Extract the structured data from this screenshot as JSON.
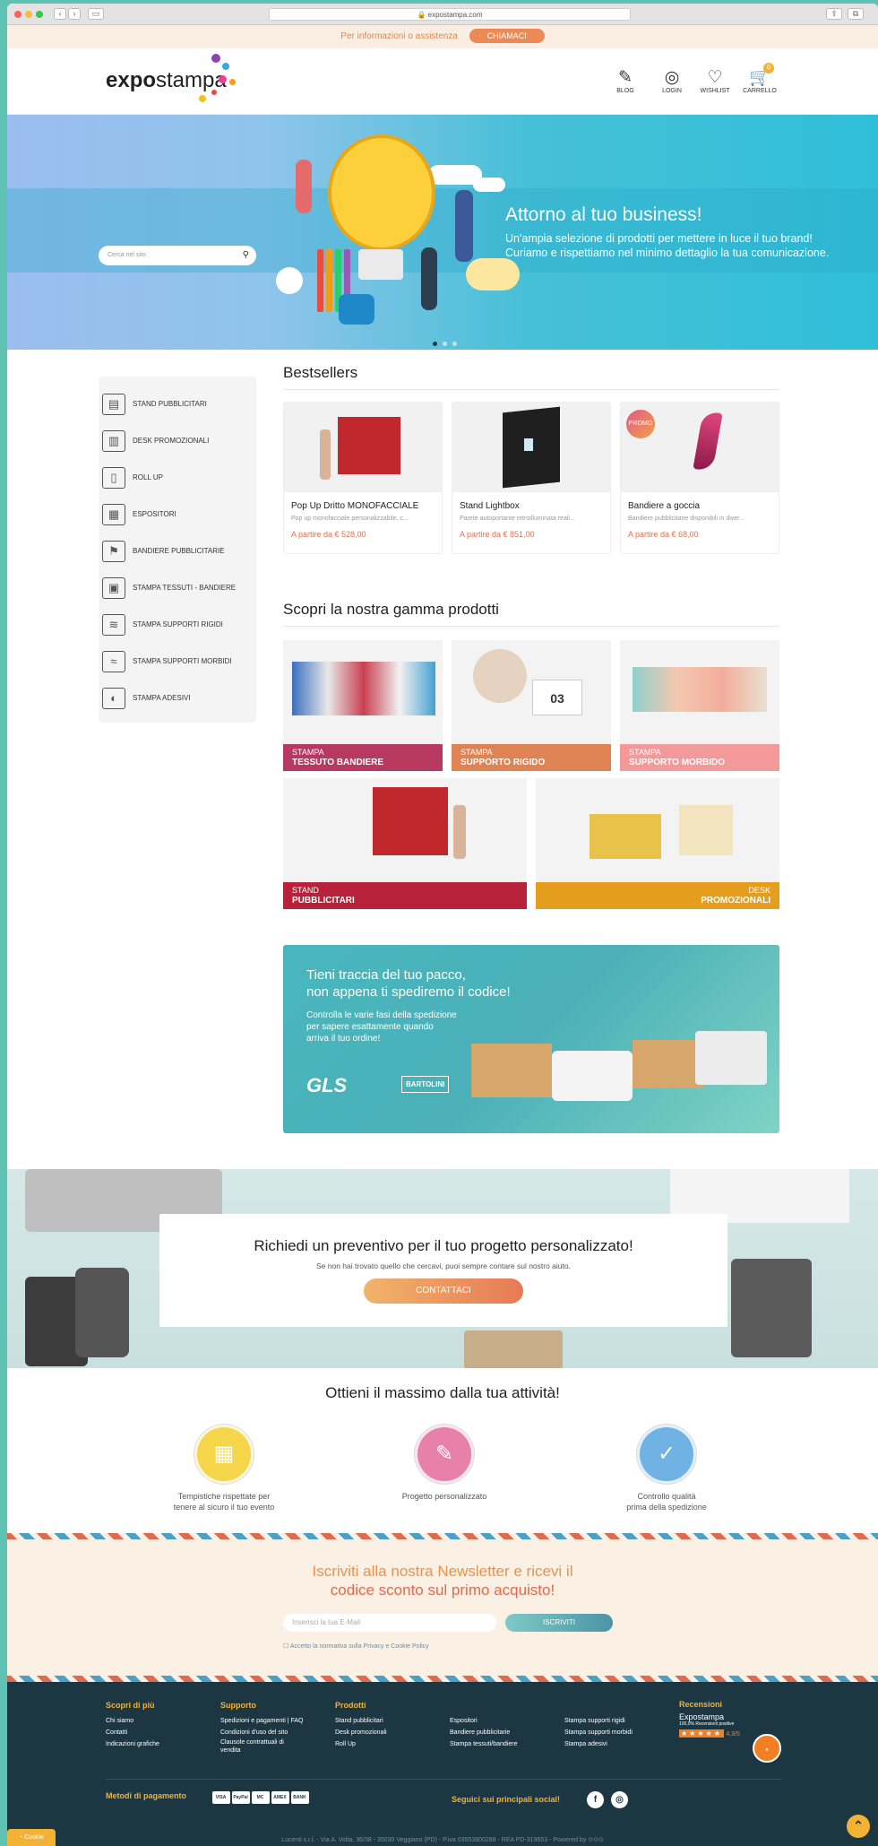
{
  "browser": {
    "url": "expostampa.com"
  },
  "topbar": {
    "text": "Per informazioni o assistenza",
    "button": "CHIAMACI"
  },
  "header": {
    "logo_bold": "expo",
    "logo_rest": "stampa",
    "icons": [
      {
        "label": "BLOG"
      },
      {
        "label": "LOGIN"
      },
      {
        "label": "WISHLIST"
      },
      {
        "label": "CARRELLO",
        "badge": "0"
      }
    ]
  },
  "hero": {
    "search_placeholder": "Cerca nel sito",
    "title": "Attorno al tuo business!",
    "line1": "Un'ampia selezione di prodotti per mettere in luce il tuo brand!",
    "line2": "Curiamo e rispettiamo nel minimo dettaglio la tua comunicazione."
  },
  "sidebar": {
    "items": [
      {
        "label": "STAND PUBBLICITARI"
      },
      {
        "label": "DESK PROMOZIONALI"
      },
      {
        "label": "ROLL UP"
      },
      {
        "label": "ESPOSITORI"
      },
      {
        "label": "BANDIERE PUBBLICITARIE"
      },
      {
        "label": "STAMPA TESSUTI - BANDIERE"
      },
      {
        "label": "STAMPA SUPPORTI RIGIDI"
      },
      {
        "label": "STAMPA SUPPORTI MORBIDI"
      },
      {
        "label": "STAMPA ADESIVI"
      }
    ]
  },
  "bestsellers": {
    "title": "Bestsellers",
    "products": [
      {
        "name": "Pop Up Dritto MONOFACCIALE",
        "desc": "Pop up monofacciale personalizzabile, c...",
        "price": "A partire da € 528,00"
      },
      {
        "name": "Stand Lightbox",
        "desc": "Parete autoportante retroilluminata reali...",
        "price": "A partire da € 851,00"
      },
      {
        "name": "Bandiere a goccia",
        "desc": "Bandiere pubblicitarie disponibili in diver...",
        "price": "A partire da € 68,00",
        "badge": "PROMO"
      }
    ]
  },
  "range": {
    "title": "Scopri la nostra gamma prodotti",
    "items": [
      {
        "top": "STAMPA",
        "bottom": "TESSUTO BANDIERE",
        "color": "#b8395f"
      },
      {
        "top": "STAMPA",
        "bottom": "SUPPORTO RIGIDO",
        "color": "#df8355"
      },
      {
        "top": "STAMPA",
        "bottom": "SUPPORTO MORBIDO",
        "color": "#f3999a"
      },
      {
        "top": "STAND",
        "bottom": "PUBBLICITARI",
        "color": "#b7213a"
      },
      {
        "top": "DESK",
        "bottom": "PROMOZIONALI",
        "color": "#e59d1d"
      }
    ]
  },
  "shipping": {
    "title1": "Tieni traccia del tuo pacco,",
    "title2": "non appena ti spediremo il codice!",
    "p1": "Controlla le varie fasi della spedizione",
    "p2": "per sapere esattamente quando",
    "p3": "arriva il tuo ordine!",
    "gls": "GLS",
    "bartolini": "BARTOLINI"
  },
  "quote": {
    "title": "Richiedi un preventivo per il tuo progetto personalizzato!",
    "text": "Se non hai trovato quello che cercavi, puoi sempre contare sul nostro aiuto.",
    "button": "CONTATTACI"
  },
  "features": {
    "title": "Ottieni il massimo dalla tua attività!",
    "items": [
      {
        "l1": "Tempistiche rispettate per",
        "l2": "tenere al sicuro il tuo evento",
        "color": "#f5d54a"
      },
      {
        "l1": "Progetto personalizzato",
        "l2": "",
        "color": "#e781a9"
      },
      {
        "l1": "Controllo qualità",
        "l2": "prima della spedizione",
        "color": "#6fb2e3"
      }
    ]
  },
  "newsletter": {
    "title1": "Iscriviti alla nostra Newsletter e ricevi il",
    "title2": "codice sconto sul primo acquisto!",
    "placeholder": "Inserisci la tua E-Mail",
    "button": "ISCRIVITI",
    "privacy": "Accetto la normativa sulla Privacy e Cookie Policy"
  },
  "footer": {
    "cols": [
      {
        "title": "Scopri di più",
        "links": [
          "Chi siamo",
          "Contatti",
          "Indicazioni grafiche"
        ]
      },
      {
        "title": "Supporto",
        "links": [
          "Spedizioni e pagamenti | FAQ",
          "Condizioni d'uso del sito",
          "Clausole contrattuali di",
          "vendita"
        ]
      },
      {
        "title": "Prodotti",
        "links": [
          "Stand pubblicitari",
          "Desk promozionali",
          "Roll Up"
        ]
      },
      {
        "title": "",
        "links": [
          "Espositori",
          "Bandiere pubblicitarie",
          "Stampa tessuti/bandiere"
        ]
      },
      {
        "title": "",
        "links": [
          "Stampa supporti rigidi",
          "Stampa supporti morbidi",
          "Stampa adesivi"
        ]
      }
    ],
    "reviews_title": "Recensioni",
    "reviews_name": "Expostampa",
    "reviews_sub": "100,0% Recensioni positive",
    "reviews_score": "4,9/5",
    "payment": "Metodi di pagamento",
    "payment_cards": [
      "VISA",
      "PayPal",
      "MC",
      "AMEX",
      "BANK"
    ],
    "social": "Seguici sui principali social!",
    "copyright": "Lucenti s.r.l. - Via A. Volta, 36/38 - 35030 Veggiano (PD) - P.iva 03553800288 - REA PD-319653 - Powered by",
    "cookie": "Cookie"
  }
}
